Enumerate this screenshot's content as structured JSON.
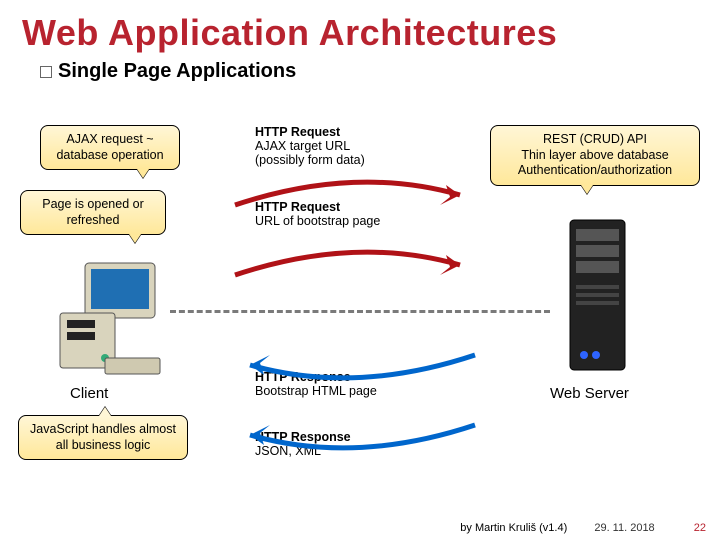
{
  "title": "Web Application Architectures",
  "subtitle": "Single Page Applications",
  "callouts": {
    "ajax_op": "AJAX request ~ database operation",
    "page_open": "Page is opened or refreshed",
    "rest_api": "REST (CRUD) API\nThin layer above database\nAuthentication/authorization",
    "js_logic": "JavaScript handles almost all business logic"
  },
  "messages": {
    "req1": {
      "head": "HTTP Request",
      "body": "AJAX target URL\n(possibly form data)"
    },
    "req2": {
      "head": "HTTP Request",
      "body": "URL of bootstrap page"
    },
    "res1": {
      "head": "HTTP Response",
      "body": "Bootstrap HTML page"
    },
    "res2": {
      "head": "HTTP Response",
      "body": "JSON, XML"
    }
  },
  "labels": {
    "client": "Client",
    "server": "Web Server"
  },
  "footer": {
    "by": "by Martin Kruliš (v1.4)",
    "date": "29. 11. 2018",
    "page": "22"
  }
}
